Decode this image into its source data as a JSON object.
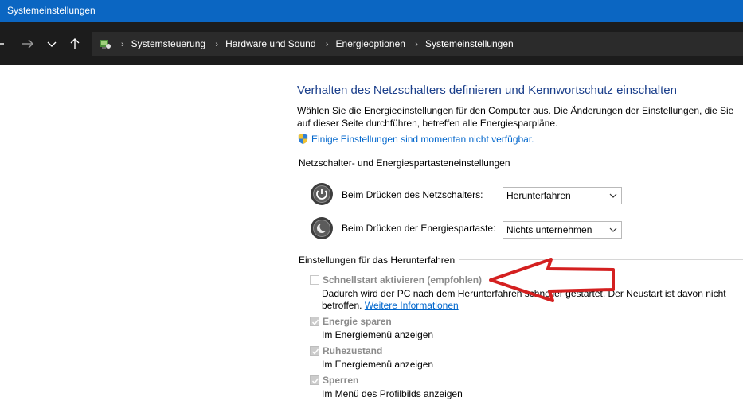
{
  "window": {
    "title": "Systemeinstellungen"
  },
  "breadcrumb": [
    "Systemsteuerung",
    "Hardware und Sound",
    "Energieoptionen",
    "Systemeinstellungen"
  ],
  "content": {
    "heading": "Verhalten des Netzschalters definieren und Kennwortschutz einschalten",
    "intro": "Wählen Sie die Energieeinstellungen für den Computer aus. Die Änderungen der Einstellungen, die Sie auf dieser Seite durchführen, betreffen alle Energiesparpläne.",
    "unavailable_link": "Einige Einstellungen sind momentan nicht verfügbar.",
    "buttons_group": {
      "title": "Netzschalter- und Energiespartasteneinstellungen",
      "power_button": {
        "label": "Beim Drücken des Netzschalters:",
        "value": "Herunterfahren"
      },
      "sleep_button": {
        "label": "Beim Drücken der Energiespartaste:",
        "value": "Nichts unternehmen"
      }
    },
    "shutdown_group": {
      "title": "Einstellungen für das Herunterfahren",
      "items": [
        {
          "label": "Schnellstart aktivieren (empfohlen)",
          "checked": false,
          "desc_line1": "Dadurch wird der PC nach dem Herunterfahren schneller gestartet. Der Neustart ist davon nicht",
          "desc_line2": "betroffen.",
          "more_link": "Weitere Informationen"
        },
        {
          "label": "Energie sparen",
          "checked": true,
          "desc": "Im Energiemenü anzeigen"
        },
        {
          "label": "Ruhezustand",
          "checked": true,
          "desc": "Im Energiemenü anzeigen"
        },
        {
          "label": "Sperren",
          "checked": true,
          "desc": "Im Menü des Profilbilds anzeigen"
        }
      ]
    }
  },
  "colors": {
    "titlebar": "#0b66c2",
    "navbar": "#1c1c1c",
    "heading": "#1b3f8b",
    "link": "#0066cc",
    "annotation_arrow": "#d42020"
  },
  "icons": [
    "back-arrow-icon",
    "forward-arrow-icon",
    "chevron-down-icon",
    "up-arrow-icon",
    "control-panel-icon",
    "shield-icon",
    "power-icon",
    "sleep-moon-icon",
    "check-icon"
  ]
}
